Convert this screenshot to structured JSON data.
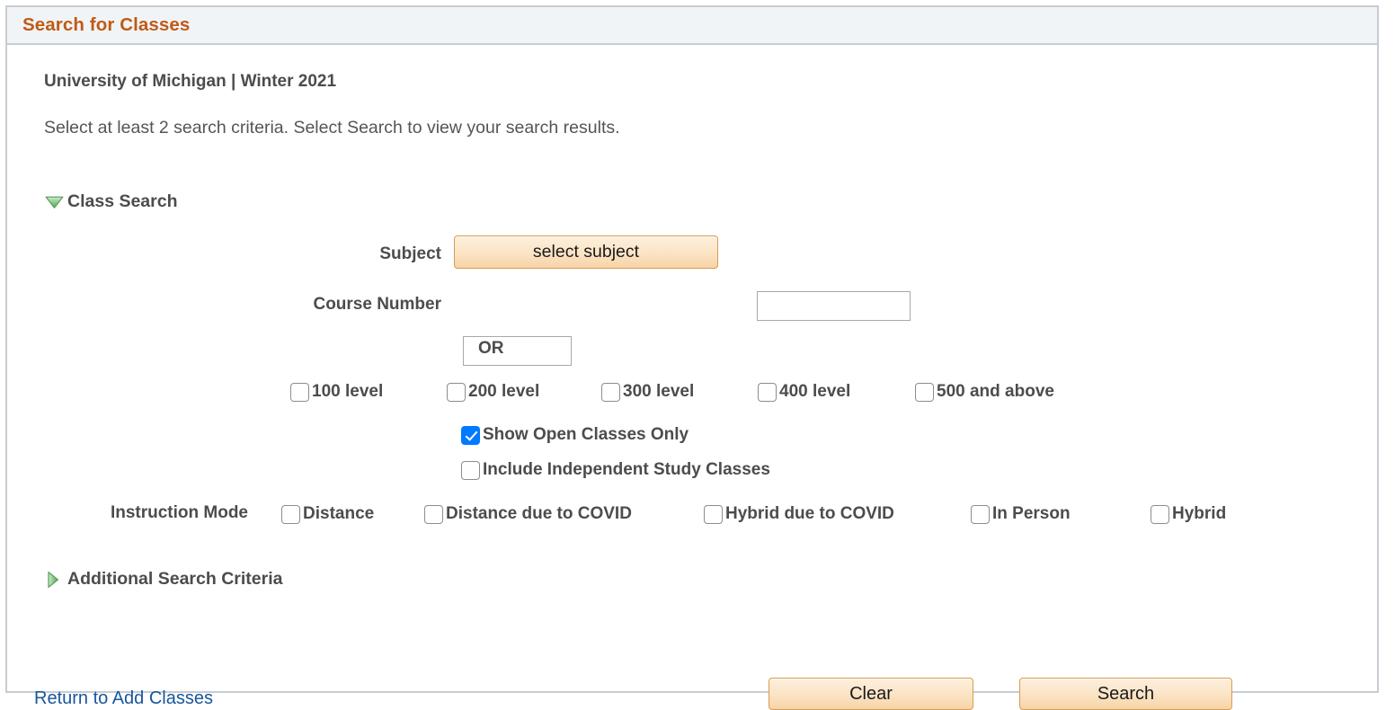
{
  "panel": {
    "title": "Search for Classes"
  },
  "header": {
    "term_line": "University of Michigan | Winter 2021",
    "instructions": "Select at least 2 search criteria. Select Search to view your search results."
  },
  "sections": {
    "class_search": {
      "label": "Class Search",
      "expanded": true,
      "toggle_icon": "triangle-down-icon"
    },
    "additional_search_criteria": {
      "label": "Additional Search Criteria",
      "expanded": false,
      "toggle_icon": "triangle-right-icon"
    }
  },
  "form": {
    "subject": {
      "label": "Subject",
      "button_label": "select subject",
      "input_value": "",
      "input_placeholder": ""
    },
    "course_number": {
      "label": "Course Number",
      "input_value": "",
      "input_placeholder": ""
    },
    "or_separator": "OR",
    "course_levels": [
      {
        "label": "100 level",
        "checked": false
      },
      {
        "label": "200 level",
        "checked": false
      },
      {
        "label": "300 level",
        "checked": false
      },
      {
        "label": "400 level",
        "checked": false
      },
      {
        "label": "500 and above",
        "checked": false
      }
    ],
    "options": [
      {
        "label": "Show Open Classes Only",
        "checked": true
      },
      {
        "label": "Include Independent Study Classes",
        "checked": false
      }
    ],
    "instruction_mode": {
      "label": "Instruction Mode",
      "modes": [
        {
          "label": "Distance",
          "checked": false
        },
        {
          "label": "Distance due to COVID",
          "checked": false
        },
        {
          "label": "Hybrid due to COVID",
          "checked": false
        },
        {
          "label": "In Person",
          "checked": false
        },
        {
          "label": "Hybrid",
          "checked": false
        }
      ]
    }
  },
  "footer": {
    "return_link": "Return to Add Classes",
    "clear_button": "Clear",
    "search_button": "Search"
  },
  "colors": {
    "title_orange": "#c05a17",
    "header_band": "#f1f4f6",
    "panel_border": "#c8ccd4",
    "button_orange_border": "#d99b52",
    "checkbox_checked": "#007aff",
    "link_blue": "#18569b",
    "text_gray": "#4c4c4c",
    "triangle_green": "#7cc67c"
  }
}
